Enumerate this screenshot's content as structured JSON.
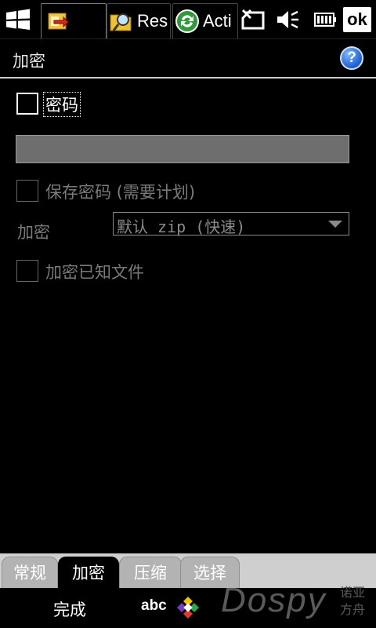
{
  "statusbar": {
    "tabs": [
      {
        "label": "",
        "icon": "contacts-transfer-icon"
      },
      {
        "label": "Res",
        "icon": "folder-search-icon"
      },
      {
        "label": "Acti",
        "icon": "activesync-icon"
      }
    ],
    "icons": [
      "windows-start-icon",
      "connectivity-icon",
      "volume-icon",
      "battery-icon"
    ],
    "ok_label": "ok"
  },
  "title": "加密",
  "help_label": "?",
  "password": {
    "checkbox_label": "密码",
    "checked": false,
    "value": ""
  },
  "save_password": {
    "label": "保存密码 (需要计划)",
    "checked": false,
    "enabled": false
  },
  "encryption": {
    "label": "加密",
    "selected": "默认 zip (快速)",
    "enabled": false
  },
  "encrypt_known": {
    "label": "加密已知文件",
    "checked": false,
    "enabled": false
  },
  "tabs": [
    {
      "label": "常规",
      "active": false
    },
    {
      "label": "加密",
      "active": true
    },
    {
      "label": "压缩",
      "active": false
    },
    {
      "label": "选择",
      "active": false
    }
  ],
  "softkeys": {
    "left": "完成",
    "input_mode": "abc"
  },
  "watermark": {
    "brand": "Dospy",
    "sub": "诺亚方舟"
  },
  "colors": {
    "background": "#000000",
    "input_fill": "#6e6e6e",
    "disabled_text": "#7a7a7a",
    "tab_inactive": "#b3b3b3",
    "tab_strip": "#cfcfcf",
    "help_blue": "#1b5fd1"
  }
}
